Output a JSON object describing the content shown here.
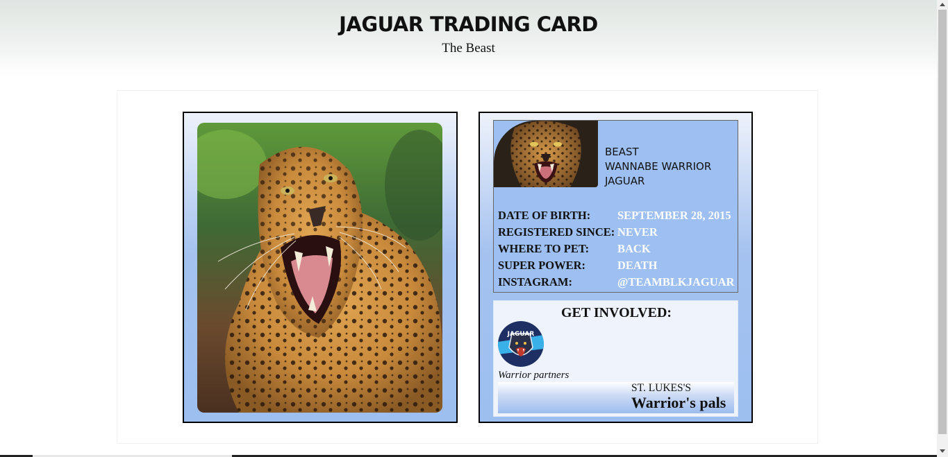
{
  "header": {
    "title": "JAGUAR TRADING CARD",
    "subtitle": "The Beast"
  },
  "card_front": {
    "image": "snarling-jaguar-photo"
  },
  "card_back": {
    "avatar_image": "jaguar-face-photo",
    "names": [
      "BEAST",
      "WANNABE WARRIOR",
      "JAGUAR"
    ],
    "stats": [
      {
        "label": "DATE OF BIRTH:",
        "value": "SEPTEMBER 28, 2015"
      },
      {
        "label": "REGISTERED SINCE:",
        "value": "NEVER"
      },
      {
        "label": "WHERE TO PET:",
        "value": "BACK"
      },
      {
        "label": "SUPER POWER:",
        "value": "DEATH"
      },
      {
        "label": "INSTAGRAM:",
        "value": "@TEAMBLKJAGUAR"
      }
    ],
    "involved": {
      "title": "GET INVOLVED:",
      "badge_text": "JAGUAR",
      "partners_caption": "Warrior partners",
      "pals_sub": "ST. LUKES'S",
      "pals_main": "Warrior's pals"
    }
  },
  "colors": {
    "card_blue": "#9cbff0",
    "value_text": "#ffffff",
    "border": "#000000"
  }
}
